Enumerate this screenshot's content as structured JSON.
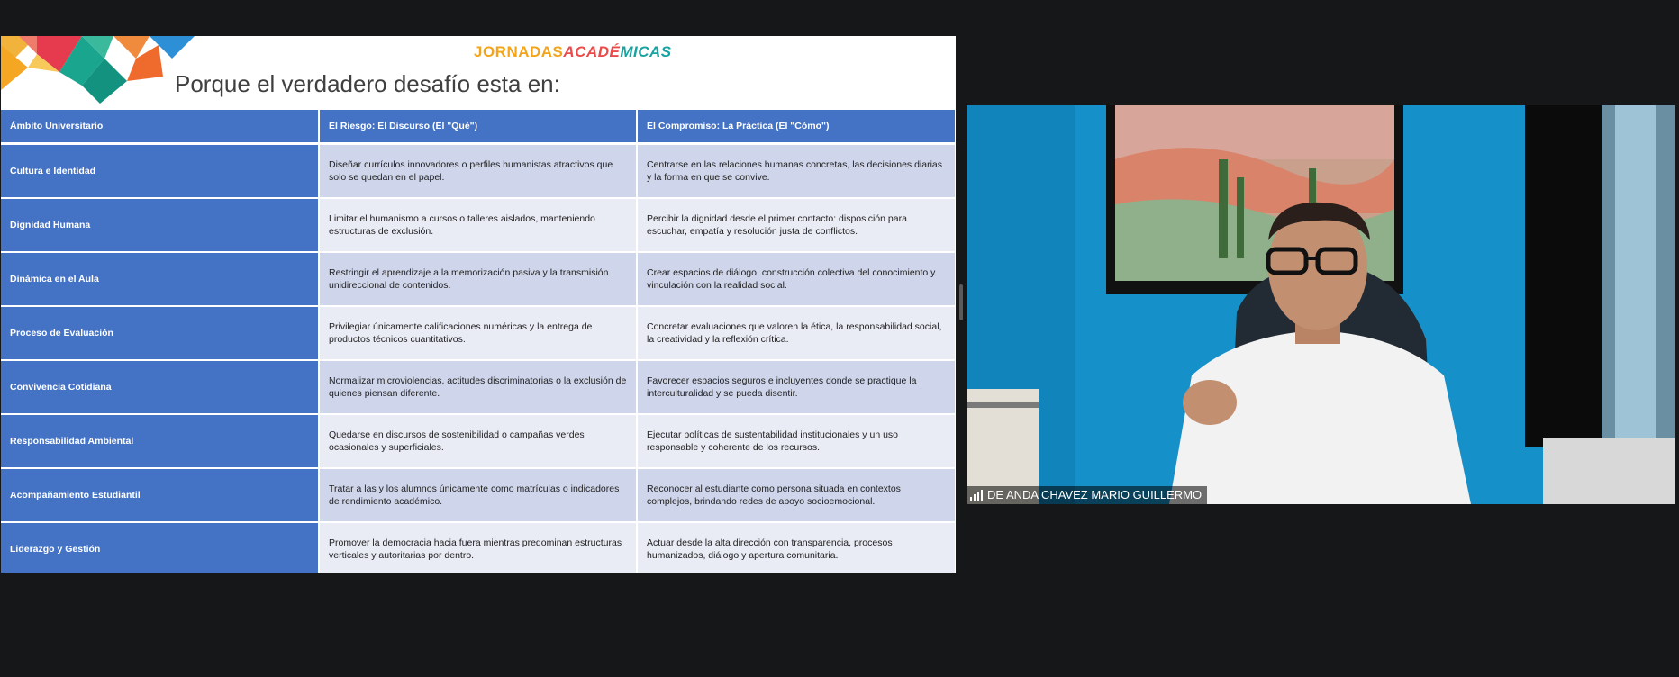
{
  "slide": {
    "logo": {
      "part1": "JORNADAS",
      "part2": "ACADÉ",
      "part3": "MICAS"
    },
    "title": "Porque el verdadero desafío esta en:",
    "table": {
      "headers": [
        "Ámbito Universitario",
        "El Riesgo: El Discurso (El \"Qué\")",
        "El Compromiso: La Práctica (El \"Cómo\")"
      ],
      "rows": [
        {
          "area": "Cultura e Identidad",
          "risk": "Diseñar currículos innovadores o perfiles humanistas atractivos que solo se quedan en el papel.",
          "commitment": "Centrarse en las relaciones humanas concretas, las decisiones diarias y la forma en que se convive."
        },
        {
          "area": "Dignidad Humana",
          "risk": "Limitar el humanismo a cursos o talleres aislados, manteniendo estructuras de exclusión.",
          "commitment": "Percibir la dignidad desde el primer contacto: disposición para escuchar, empatía y resolución justa de conflictos."
        },
        {
          "area": "Dinámica en el Aula",
          "risk": "Restringir el aprendizaje a la memorización pasiva y la transmisión unidireccional de contenidos.",
          "commitment": "Crear espacios de diálogo, construcción colectiva del conocimiento y vinculación con la realidad social."
        },
        {
          "area": "Proceso de Evaluación",
          "risk": "Privilegiar únicamente calificaciones numéricas y la entrega de productos técnicos cuantitativos.",
          "commitment": "Concretar evaluaciones que valoren la ética, la responsabilidad social, la creatividad y la reflexión crítica."
        },
        {
          "area": "Convivencia Cotidiana",
          "risk": "Normalizar microviolencias, actitudes discriminatorias o la exclusión de quienes piensan diferente.",
          "commitment": "Favorecer espacios seguros e incluyentes donde se practique la interculturalidad y se pueda disentir."
        },
        {
          "area": "Responsabilidad Ambiental",
          "risk": "Quedarse en discursos de sostenibilidad o campañas verdes ocasionales y superficiales.",
          "commitment": "Ejecutar políticas de sustentabilidad institucionales y un uso responsable y coherente de los recursos."
        },
        {
          "area": "Acompañamiento Estudiantil",
          "risk": "Tratar a las y los alumnos únicamente como matrículas o indicadores de rendimiento académico.",
          "commitment": "Reconocer al estudiante como persona situada en contextos complejos, brindando redes de apoyo socioemocional."
        },
        {
          "area": "Liderazgo y Gestión",
          "risk": "Promover la democracia hacia fuera mientras predominan estructuras verticales y autoritarias por dentro.",
          "commitment": "Actuar desde la alta dirección con transparencia, procesos humanizados, diálogo y apertura comunitaria."
        }
      ]
    }
  },
  "video": {
    "participant_name": "DE ANDA CHAVEZ MARIO GUILLERMO",
    "signal_icon": "signal-bars-icon"
  },
  "colors": {
    "header_blue": "#4472c4",
    "row_dark": "#cfd5ea",
    "row_light": "#e9ebf5",
    "wall_blue": "#1590c9",
    "background": "#161718"
  }
}
